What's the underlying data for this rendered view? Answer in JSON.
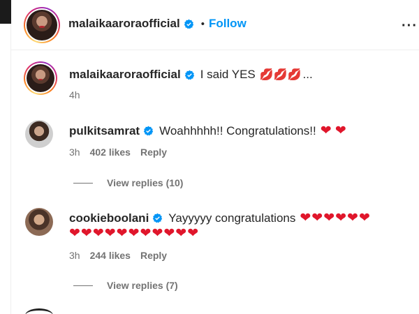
{
  "post_header": {
    "username": "malaikaaroraofficial",
    "separator": "•",
    "follow_label": "Follow",
    "more_icon": "more-options-icon"
  },
  "caption": {
    "username": "malaikaaroraofficial",
    "text": "I said YES",
    "emoji": "💋💋💋",
    "ellipsis": "...",
    "time": "4h"
  },
  "comments": [
    {
      "username": "pulkitsamrat",
      "text": "Woahhhhh!! Congratulations!!",
      "emoji": "❤ ❤",
      "time": "3h",
      "likes": "402 likes",
      "reply_label": "Reply",
      "view_replies": "View replies (10)"
    },
    {
      "username": "cookieboolani",
      "text": "Yayyyyy congratulations",
      "emoji": "❤❤❤❤❤❤",
      "emoji_line2": "❤❤❤❤❤❤❤❤❤❤❤",
      "time": "3h",
      "likes": "244 likes",
      "reply_label": "Reply",
      "view_replies": "View replies (7)"
    }
  ],
  "colors": {
    "follow_blue": "#0095f6",
    "verified_blue": "#0095f6",
    "heart_red": "#e0162b",
    "meta_gray": "#737373"
  }
}
